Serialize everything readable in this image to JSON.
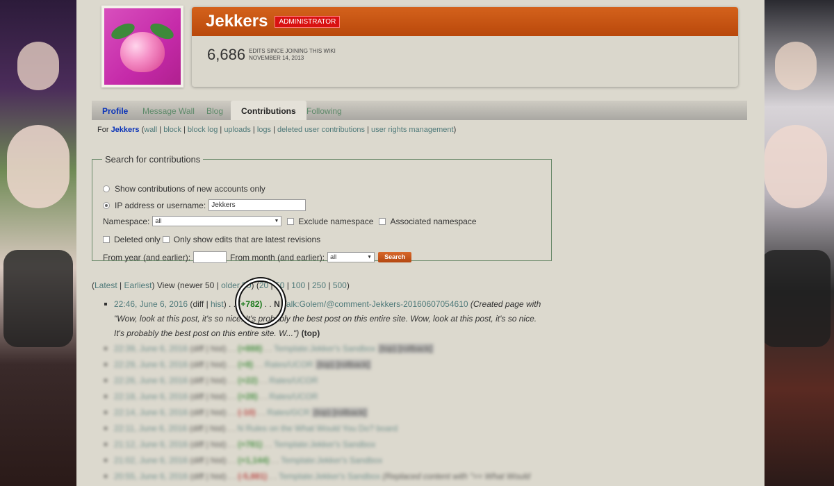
{
  "colors": {
    "accent": "#b9480b",
    "badge": "#d91111",
    "link": "#4f7a7a",
    "strong_link": "#0a33b8"
  },
  "header": {
    "username": "Jekkers",
    "badge": "ADMINISTRATOR",
    "edit_count": "6,686",
    "edit_label": "EDITS SINCE JOINING THIS WIKI",
    "join_date": "NOVEMBER 14, 2013",
    "avatar_icon": "peach-icon"
  },
  "tabs": [
    "Profile",
    "Message Wall",
    "Blog",
    "Contributions",
    "Following"
  ],
  "active_tab": "Contributions",
  "sublinks": {
    "prefix": "For",
    "user": "Jekkers",
    "links": [
      "wall",
      "block",
      "block log",
      "uploads",
      "logs",
      "deleted user contributions",
      "user rights management"
    ]
  },
  "search": {
    "legend": "Search for contributions",
    "opt_new_accounts": "Show contributions of new accounts only",
    "opt_ip": "IP address or username:",
    "username_value": "Jekkers",
    "namespace_label": "Namespace:",
    "namespace_value": "all",
    "exclude_ns": "Exclude namespace",
    "assoc_ns": "Associated namespace",
    "deleted_only": "Deleted only",
    "latest_only": "Only show edits that are latest revisions",
    "from_year": "From year (and earlier):",
    "from_month": "From month (and earlier):",
    "month_value": "all",
    "button": "Search"
  },
  "nav": {
    "latest": "Latest",
    "earliest": "Earliest",
    "view_text": "View (newer 50 |",
    "older": "older 50",
    "counts": [
      "20",
      "50",
      "100",
      "250",
      "500"
    ]
  },
  "entries": [
    {
      "time": "22:46, June 6, 2016",
      "diff": "diff",
      "hist": "hist",
      "size": "(+782)",
      "sign": "pos",
      "new": "N",
      "page": "Talk:Golem/@comment-Jekkers-20160607054610",
      "comment": "(Created page with \"Wow, look at this post, it's so nice. It's probably the best post on this entire site. Wow, look at this post, it's so nice. It's probably the best post on this entire site. W...\")",
      "top": "(top)"
    },
    {
      "time": "22:39, June 6, 2016",
      "size": "(+888)",
      "sign": "pos",
      "page": "Template:Jekker's Sandbox",
      "extra": "(top) [rollback]"
    },
    {
      "time": "22:29, June 6, 2016",
      "size": "(+8)",
      "sign": "pos",
      "page": "Rates/UCOR",
      "extra": "(top) [rollback]"
    },
    {
      "time": "22:26, June 6, 2016",
      "size": "(+22)",
      "sign": "pos",
      "page": "Rates/UCOR",
      "extra": ""
    },
    {
      "time": "22:18, June 6, 2016",
      "size": "(+28)",
      "sign": "pos",
      "page": "Rates/UCOR",
      "extra": ""
    },
    {
      "time": "22:14, June 6, 2016",
      "size": "(-10)",
      "sign": "neg",
      "page": "Rates/GCR",
      "extra": "(top) [rollback]"
    },
    {
      "time": "22:11, June 6, 2016",
      "size": "",
      "sign": "pos",
      "page": "N Rules on the What Would You Do? board",
      "extra": ""
    },
    {
      "time": "21:12, June 6, 2016",
      "size": "(+781)",
      "sign": "pos",
      "page": "Template:Jekker's Sandbox",
      "extra": ""
    },
    {
      "time": "21:02, June 6, 2016",
      "size": "(+1,144)",
      "sign": "pos",
      "page": "Template:Jekker's Sandbox",
      "extra": ""
    },
    {
      "time": "20:55, June 6, 2016",
      "size": "(-5,881)",
      "sign": "neg",
      "page": "Template:Jekker's Sandbox",
      "extra": "(Replaced content with \"== What Would"
    }
  ]
}
